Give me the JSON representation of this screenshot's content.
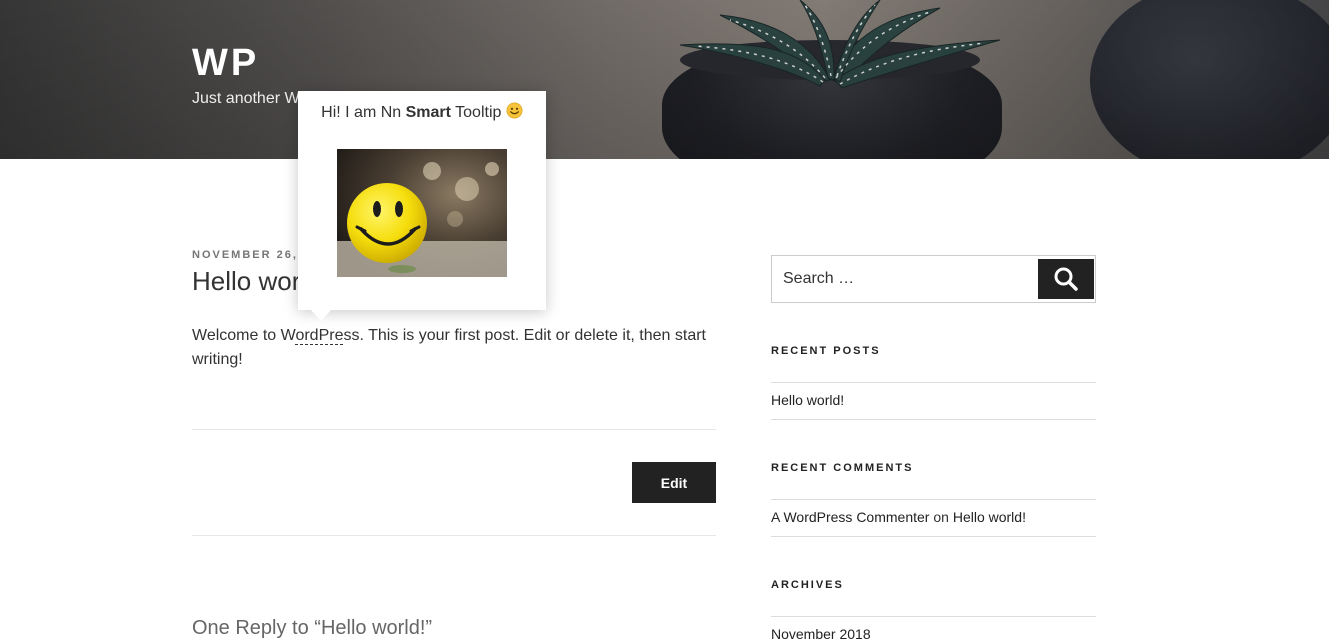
{
  "header": {
    "site_title": "WP",
    "site_description": "Just another W"
  },
  "post": {
    "date": "NOVEMBER 26,",
    "title": "Hello wor",
    "body_before": "Welcome to W",
    "tooltip_word": "ordPre",
    "body_after": "ss. This is your first post. Edit or delete it, then start writing!",
    "edit_label": "Edit",
    "replies_heading": "One Reply to “Hello world!”"
  },
  "tooltip": {
    "text_prefix": "Hi! I am Nn ",
    "text_bold": "Smart",
    "text_suffix": " Tooltip",
    "emoji": "smiley-emoji",
    "image": "smiley-ball-image"
  },
  "sidebar": {
    "search": {
      "placeholder": "Search …",
      "button": "search-icon"
    },
    "recent_posts": {
      "title": "RECENT POSTS",
      "items": [
        "Hello world!"
      ]
    },
    "recent_comments": {
      "title": "RECENT COMMENTS",
      "items": [
        {
          "author": "A WordPress Commenter",
          "connector": "on",
          "post": "Hello world!"
        }
      ]
    },
    "archives": {
      "title": "ARCHIVES",
      "items": [
        "November 2018"
      ]
    }
  },
  "colors": {
    "button": "#222222",
    "text": "#333333",
    "meta": "#767676",
    "rule": "#e6e6e6"
  }
}
